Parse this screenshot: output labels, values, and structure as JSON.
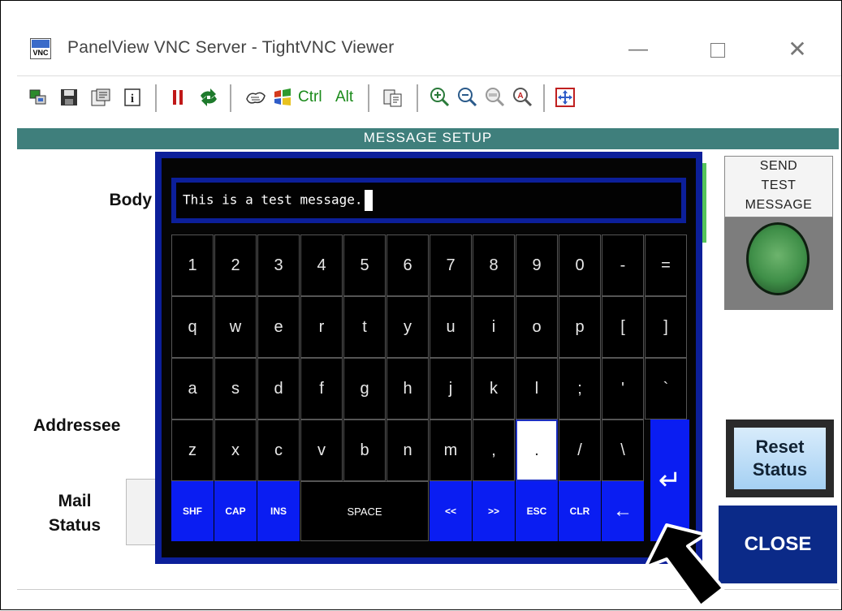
{
  "window": {
    "title": "PanelView VNC Server - TightVNC Viewer",
    "app_icon_text": "VNC",
    "minimize_glyph": "—",
    "close_glyph": "✕"
  },
  "toolbar": {
    "ctrl_label": "Ctrl",
    "alt_label": "Alt"
  },
  "screen": {
    "header_title": "MESSAGE SETUP",
    "labels": {
      "body": "Body",
      "addressee": "Addressee",
      "mail": "Mail",
      "status": "Status"
    },
    "send_button": {
      "line1": "SEND",
      "line2": "TEST",
      "line3": "MESSAGE"
    },
    "reset_button": {
      "line1": "Reset",
      "line2": "Status"
    },
    "close_button": "CLOSE"
  },
  "keyboard": {
    "entry_text": "This is a test message.",
    "rows": [
      [
        "1",
        "2",
        "3",
        "4",
        "5",
        "6",
        "7",
        "8",
        "9",
        "0",
        "-",
        "="
      ],
      [
        "q",
        "w",
        "e",
        "r",
        "t",
        "y",
        "u",
        "i",
        "o",
        "p",
        "[",
        "]"
      ],
      [
        "a",
        "s",
        "d",
        "f",
        "g",
        "h",
        "j",
        "k",
        "l",
        ";",
        "'",
        "`"
      ],
      [
        "z",
        "x",
        "c",
        "v",
        "b",
        "n",
        "m",
        ",",
        ".",
        "/",
        "\\"
      ]
    ],
    "selected_key": ".",
    "bottom": {
      "shf": "SHF",
      "cap": "CAP",
      "ins": "INS",
      "space": "SPACE",
      "left": "<<",
      "right": ">>",
      "esc": "ESC",
      "clr": "CLR",
      "backspace": "←"
    },
    "enter_glyph": "↵"
  }
}
